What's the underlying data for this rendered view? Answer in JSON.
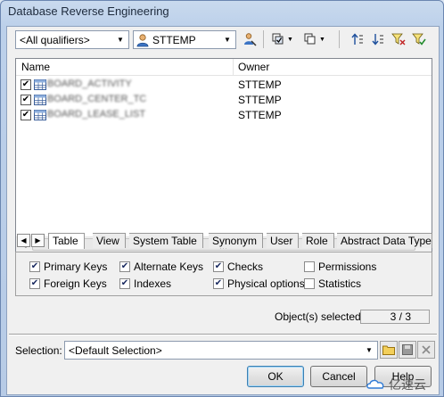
{
  "window": {
    "title": "Database Reverse Engineering"
  },
  "toolbar": {
    "qualifier_combo": "<All qualifiers>",
    "owner_combo": "STTEMP",
    "icons": [
      "owner-select-icon",
      "select-all-icon",
      "deselect-all-icon",
      "move-up-icon",
      "move-down-icon",
      "filter-icon",
      "filter-clear-icon"
    ]
  },
  "list": {
    "columns": [
      "Name",
      "Owner"
    ],
    "rows": [
      {
        "name": "BOARD_ACTIVITY",
        "owner": "STTEMP",
        "checked": true
      },
      {
        "name": "BOARD_CENTER_TC",
        "owner": "STTEMP",
        "checked": true
      },
      {
        "name": "BOARD_LEASE_LIST",
        "owner": "STTEMP",
        "checked": true
      }
    ]
  },
  "tabs": [
    "Table",
    "View",
    "System Table",
    "Synonym",
    "User",
    "Role",
    "Abstract Data Type"
  ],
  "options": [
    {
      "label": "Primary Keys",
      "checked": true
    },
    {
      "label": "Alternate Keys",
      "checked": true
    },
    {
      "label": "Checks",
      "checked": true
    },
    {
      "label": "Permissions",
      "checked": false
    },
    {
      "label": "Foreign Keys",
      "checked": true
    },
    {
      "label": "Indexes",
      "checked": true
    },
    {
      "label": "Physical options",
      "checked": true
    },
    {
      "label": "Statistics",
      "checked": false
    }
  ],
  "selection_info": {
    "label": "Object(s) selected:",
    "count": "3 / 3"
  },
  "selection": {
    "label": "Selection:",
    "value": "<Default Selection>"
  },
  "buttons": {
    "ok": "OK",
    "cancel": "Cancel",
    "help": "Help"
  },
  "watermark": {
    "text": "亿速云"
  }
}
